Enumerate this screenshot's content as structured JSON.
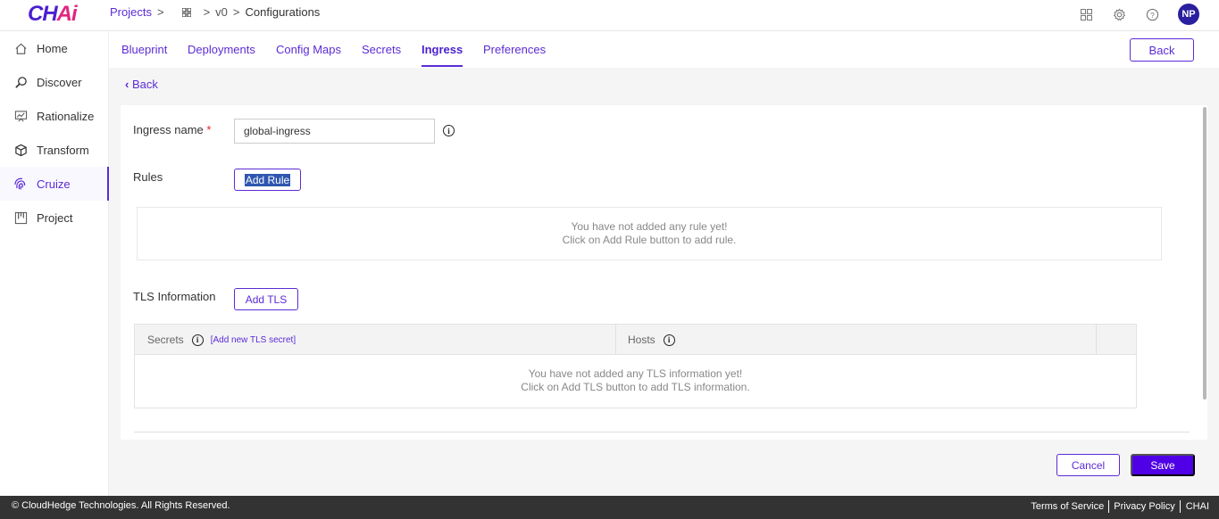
{
  "app": {
    "logo_main": "CH",
    "logo_ai": "Ai"
  },
  "breadcrumb": {
    "projects": "Projects",
    "version": "v0",
    "current": "Configurations"
  },
  "user": {
    "initials": "NP"
  },
  "sidebar": {
    "items": [
      {
        "label": "Home",
        "icon": "home-icon"
      },
      {
        "label": "Discover",
        "icon": "discover-icon"
      },
      {
        "label": "Rationalize",
        "icon": "rationalize-icon"
      },
      {
        "label": "Transform",
        "icon": "cube-icon"
      },
      {
        "label": "Cruize",
        "icon": "fingerprint-icon",
        "active": true
      },
      {
        "label": "Project",
        "icon": "kanban-icon"
      }
    ]
  },
  "tabs": [
    {
      "label": "Blueprint"
    },
    {
      "label": "Deployments"
    },
    {
      "label": "Config Maps"
    },
    {
      "label": "Secrets"
    },
    {
      "label": "Ingress",
      "active": true
    },
    {
      "label": "Preferences"
    }
  ],
  "back_button": "Back",
  "back_link": "Back",
  "form": {
    "ingress_name_label": "Ingress name",
    "required_mark": "*",
    "ingress_name_value": "global-ingress",
    "rules_label": "Rules",
    "add_rule": "Add Rule",
    "rules_empty_line1": "You have not added any rule yet!",
    "rules_empty_line2": "Click on Add Rule button to add rule.",
    "tls_label": "TLS Information",
    "add_tls": "Add TLS",
    "tls_table": {
      "secrets_header": "Secrets",
      "add_secret_link": "[Add new TLS secret]",
      "hosts_header": "Hosts",
      "empty_line1": "You have not added any TLS information yet!",
      "empty_line2": "Click on Add TLS button to add TLS information."
    }
  },
  "actions": {
    "cancel": "Cancel",
    "save": "Save"
  },
  "footer": {
    "copyright": "© CloudHedge Technologies. All Rights Reserved.",
    "terms": "Terms of Service",
    "privacy": "Privacy Policy",
    "brand": "CHAI"
  },
  "colors": {
    "accent": "#5b2bd6",
    "primary_button": "#5000e6",
    "logo_pink": "#e0267d",
    "footer_bg": "#333333"
  }
}
